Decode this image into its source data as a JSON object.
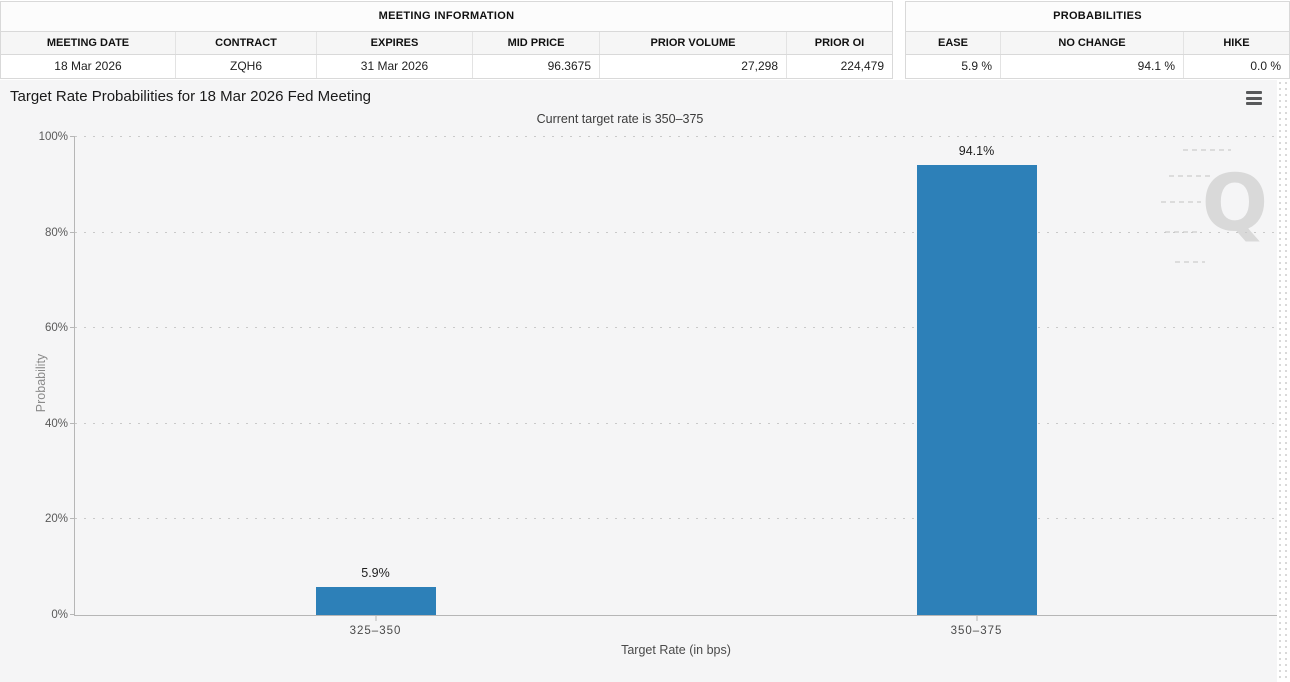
{
  "meeting_information": {
    "title": "MEETING INFORMATION",
    "columns": [
      "MEETING DATE",
      "CONTRACT",
      "EXPIRES",
      "MID PRICE",
      "PRIOR VOLUME",
      "PRIOR OI"
    ],
    "values": [
      "18 Mar 2026",
      "ZQH6",
      "31 Mar 2026",
      "96.3675",
      "27,298",
      "224,479"
    ]
  },
  "probabilities": {
    "title": "PROBABILITIES",
    "columns": [
      "EASE",
      "NO CHANGE",
      "HIKE"
    ],
    "values": [
      "5.9 %",
      "94.1 %",
      "0.0 %"
    ]
  },
  "chart_data": {
    "type": "bar",
    "title": "Target Rate Probabilities for 18 Mar 2026 Fed Meeting",
    "subtitle": "Current target rate is 350–375",
    "categories": [
      "325–350",
      "350–375"
    ],
    "values": [
      5.9,
      94.1
    ],
    "bar_labels": [
      "5.9%",
      "94.1%"
    ],
    "xlabel": "Target Rate (in bps)",
    "ylabel": "Probability",
    "ylim": [
      0,
      100
    ],
    "yticks": [
      0,
      20,
      40,
      60,
      80,
      100
    ],
    "ytick_labels": [
      "0%",
      "20%",
      "40%",
      "60%",
      "80%",
      "100%"
    ],
    "grid": "horizontal dotted",
    "legend": "none",
    "bar_color": "#2d80b8"
  },
  "icons": {
    "menu": "hamburger-icon",
    "watermark_letter": "Q"
  }
}
